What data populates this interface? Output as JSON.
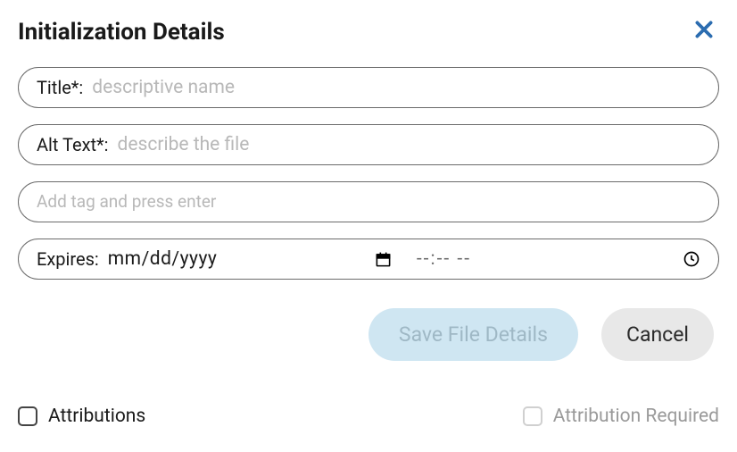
{
  "header": {
    "title": "Initialization Details"
  },
  "fields": {
    "title_label": "Title*:",
    "title_placeholder": "descriptive name",
    "title_value": "",
    "alt_label": "Alt Text*:",
    "alt_placeholder": "describe the file",
    "alt_value": "",
    "tag_placeholder": "Add tag and press enter",
    "tag_value": "",
    "expires_label": "Expires:",
    "date_value": "mm/dd/yyyy",
    "time_value": "--:-- --"
  },
  "buttons": {
    "save_label": "Save File Details",
    "cancel_label": "Cancel"
  },
  "footer": {
    "attributions_label": "Attributions",
    "attribution_required_label": "Attribution Required"
  }
}
